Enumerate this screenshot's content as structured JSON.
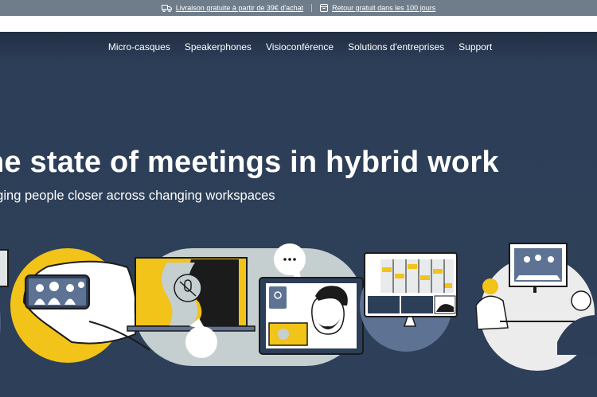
{
  "announcement": {
    "shipping_text": "Livraison gratuite à partir de 39€ d'achat",
    "returns_text": "Retour gratuit dans les 100 jours",
    "shipping_icon": "truck-icon",
    "returns_icon": "box-icon"
  },
  "nav": {
    "items": [
      "Micro-casques",
      "Speakerphones",
      "Visioconférence",
      "Solutions d'entreprises",
      "Support"
    ]
  },
  "hero": {
    "title": "he state of meetings in hybrid work",
    "subtitle": "nging people closer across changing workspaces"
  },
  "colors": {
    "background": "#2d3e58",
    "topbar": "#6f7d8b",
    "accent_yellow": "#f2c318",
    "light_grey": "#c6cfd0",
    "steel_blue": "#5e7393"
  }
}
